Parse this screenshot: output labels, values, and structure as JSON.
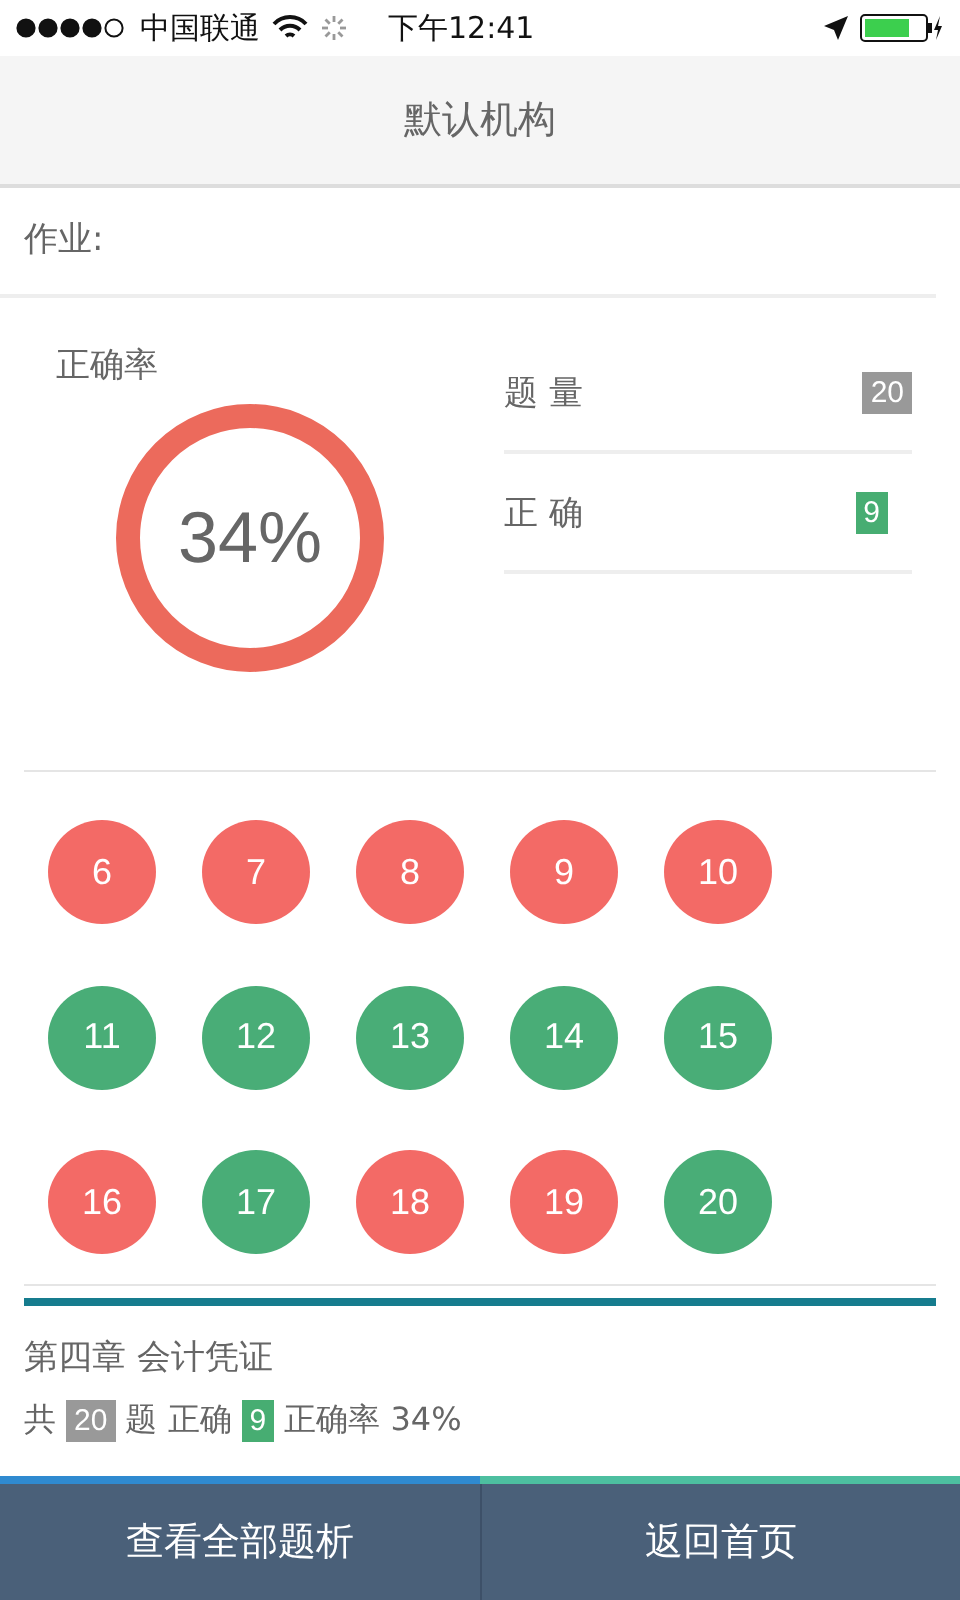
{
  "status_bar": {
    "carrier": "中国联通",
    "time": "下午12:41"
  },
  "nav": {
    "title": "默认机构"
  },
  "section_label": "作业:",
  "accuracy": {
    "label": "正确率",
    "value": "34%"
  },
  "stats": [
    {
      "label": "题 量",
      "value": "20",
      "kind": "total"
    },
    {
      "label": "正 确",
      "value": "9",
      "kind": "correct"
    }
  ],
  "questions": [
    {
      "number": "6",
      "correct": false
    },
    {
      "number": "7",
      "correct": false
    },
    {
      "number": "8",
      "correct": false
    },
    {
      "number": "9",
      "correct": false
    },
    {
      "number": "10",
      "correct": false
    },
    {
      "number": "11",
      "correct": true
    },
    {
      "number": "12",
      "correct": true
    },
    {
      "number": "13",
      "correct": true
    },
    {
      "number": "14",
      "correct": true
    },
    {
      "number": "15",
      "correct": true
    },
    {
      "number": "16",
      "correct": false
    },
    {
      "number": "17",
      "correct": true
    },
    {
      "number": "18",
      "correct": false
    },
    {
      "number": "19",
      "correct": false
    },
    {
      "number": "20",
      "correct": true
    }
  ],
  "chapter": {
    "title": "第四章 会计凭证",
    "summary": [
      {
        "text": "共",
        "kind": "text"
      },
      {
        "text": "20",
        "kind": "total"
      },
      {
        "text": "题 正确",
        "kind": "text"
      },
      {
        "text": "9",
        "kind": "correct"
      },
      {
        "text": "正确率 34%",
        "kind": "text"
      }
    ]
  },
  "progress": {
    "level": 0.5
  },
  "buttons": [
    {
      "label": "查看全部题析"
    },
    {
      "label": "返回首页"
    }
  ]
}
